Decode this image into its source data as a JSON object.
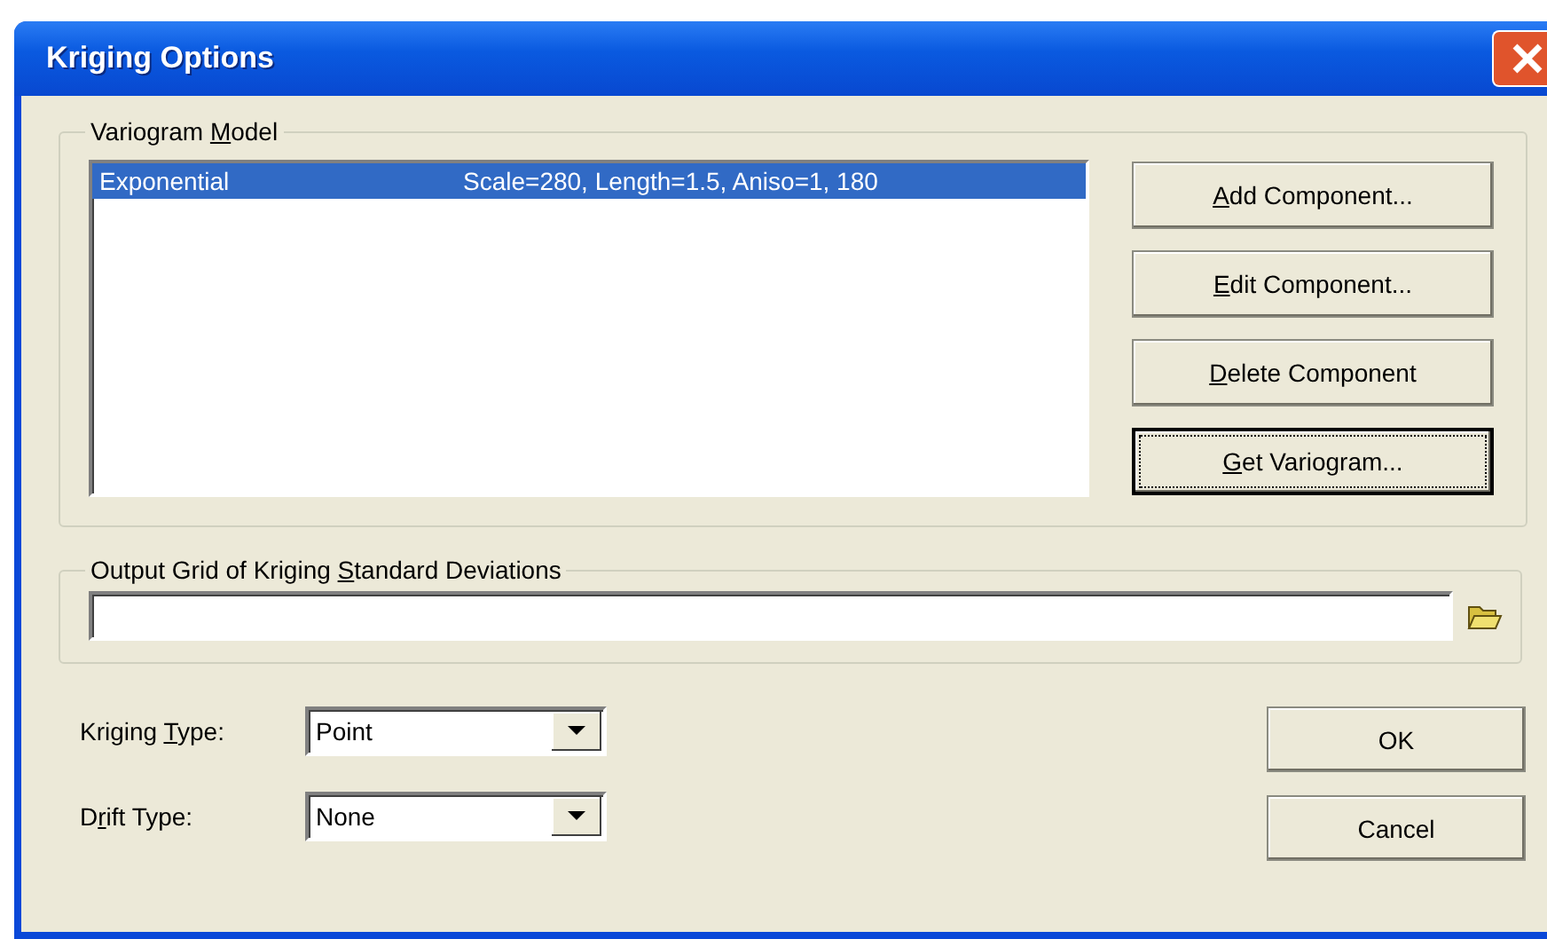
{
  "window": {
    "title": "Kriging Options"
  },
  "variogram_model": {
    "label_start": "Variogram ",
    "access_key": "M",
    "label_end": "odel",
    "components": [
      {
        "name": "Exponential",
        "parameters": "Scale=280, Length=1.5, Aniso=1, 180",
        "selected": true
      }
    ],
    "buttons": [
      {
        "access_key": "A",
        "label_end": "dd Component...",
        "focused": false
      },
      {
        "access_key": "E",
        "label_end": "dit Component...",
        "focused": false
      },
      {
        "access_key": "D",
        "label_end": "elete Component",
        "focused": false
      },
      {
        "access_key": "G",
        "label_end": "et Variogram...",
        "focused": true
      }
    ]
  },
  "output_grid": {
    "label_start": "Output Grid of Kriging ",
    "access_key": "S",
    "label_end": "tandard Deviations"
  },
  "kriging_type": {
    "label_start": "Kriging ",
    "access_key": "T",
    "label_end": "ype:",
    "value": "Point"
  },
  "drift_type": {
    "label_start": "D",
    "access_key": "r",
    "label_end": "ift Type:",
    "value": "None"
  },
  "buttons": [
    {
      "label": "OK"
    },
    {
      "label": "Cancel"
    }
  ]
}
